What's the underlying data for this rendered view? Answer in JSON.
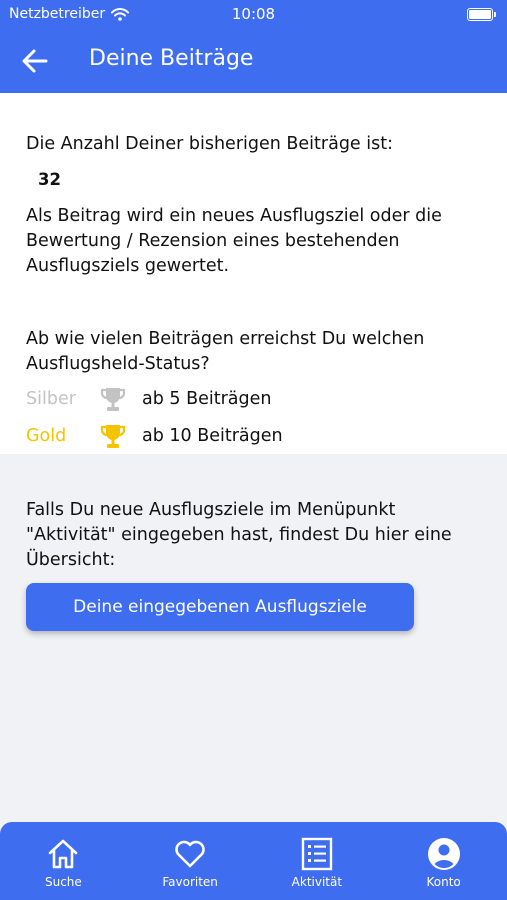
{
  "status_bar": {
    "carrier": "Netzbetreiber",
    "time": "10:08"
  },
  "header": {
    "title": "Deine Beiträge"
  },
  "content": {
    "count_intro": "Die Anzahl Deiner bisherigen Beiträge ist:",
    "count_value": "32",
    "explanation_lines": [
      "Als Beitrag wird ein neues Ausflugsziel oder die",
      "Bewertung / Rezension eines bestehenden",
      "Ausflugsziels gewertet."
    ],
    "status_question_lines": [
      "Ab wie vielen Beiträgen erreichst Du welchen",
      "Ausflugsheld-Status?"
    ],
    "status_levels": [
      {
        "name": "Silber",
        "threshold": "ab 5 Beiträgen",
        "color": "#c3c3c3"
      },
      {
        "name": "Gold",
        "threshold": "ab 10 Beiträgen",
        "color": "#f5c300"
      }
    ],
    "info_lines": [
      "Falls Du neue Ausflugsziele im Menüpunkt",
      "\"Aktivität\" eingegeben hast, findest Du hier eine",
      "Übersicht:"
    ],
    "button_label": "Deine eingegebenen Ausflugsziele"
  },
  "tab_bar": {
    "items": [
      {
        "label": "Suche",
        "icon": "home-icon"
      },
      {
        "label": "Favoriten",
        "icon": "heart-icon"
      },
      {
        "label": "Aktivität",
        "icon": "list-icon"
      },
      {
        "label": "Konto",
        "icon": "account-icon"
      }
    ]
  },
  "colors": {
    "primary": "#3f6df0",
    "background": "#f0f2f5",
    "silver": "#c3c3c3",
    "gold": "#f5c300"
  }
}
